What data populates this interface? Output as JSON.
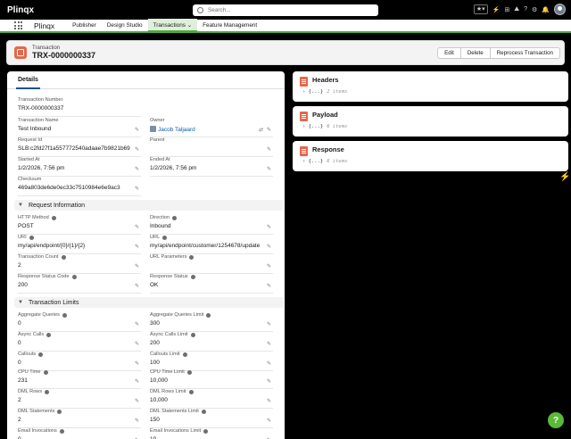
{
  "app": {
    "brand": "Plinqx",
    "search_placeholder": "Search...",
    "app_name": "Plinqx",
    "nav": [
      "Publisher",
      "Design Studio",
      "Transactions",
      "Feature Management"
    ]
  },
  "record": {
    "type": "Transaction",
    "name": "TRX-0000000337",
    "actions": [
      "Edit",
      "Delete",
      "Reprocess Transaction"
    ]
  },
  "details": {
    "tab": "Details",
    "fields": {
      "transaction_number": {
        "label": "Transaction Number",
        "value": "TRX-0000000337"
      },
      "transaction_name": {
        "label": "Transaction Name",
        "value": "Test Inbound"
      },
      "owner": {
        "label": "Owner",
        "value": "Jacob Taljaard"
      },
      "request_id": {
        "label": "Request Id",
        "value": "SLB:c2fd27f1a557772540adaae7b9821b69"
      },
      "parent": {
        "label": "Parent",
        "value": ""
      },
      "started_at": {
        "label": "Started At",
        "value": "1/2/2026, 7:56 pm"
      },
      "ended_at": {
        "label": "Ended At",
        "value": "1/2/2026, 7:56 pm"
      },
      "checksum": {
        "label": "Checksum",
        "value": "469a803de6de0ec33c7510984e6e9ac3"
      }
    }
  },
  "request_information": {
    "title": "Request Information",
    "fields": {
      "http_method": {
        "label": "HTTP Method",
        "value": "POST"
      },
      "direction": {
        "label": "Direction",
        "value": "Inbound"
      },
      "uri": {
        "label": "URI",
        "value": "my/api/endpoint/{0}/{1}/{2}"
      },
      "url": {
        "label": "URL",
        "value": "my/api/endpoint/customer/1254678/update"
      },
      "transaction_count": {
        "label": "Transaction Count",
        "value": "2"
      },
      "url_parameters": {
        "label": "URL Parameters",
        "value": ""
      },
      "response_status_code": {
        "label": "Response Status Code",
        "value": "200"
      },
      "response_status": {
        "label": "Response Status",
        "value": "OK"
      }
    }
  },
  "transaction_limits": {
    "title": "Transaction Limits",
    "fields": {
      "aggregate_queries": {
        "label": "Aggregate Queries",
        "value": "0"
      },
      "aggregate_queries_limit": {
        "label": "Aggregate Queries Limit",
        "value": "300"
      },
      "async_calls": {
        "label": "Async Calls",
        "value": "0"
      },
      "async_calls_limit": {
        "label": "Async Calls Limit",
        "value": "200"
      },
      "callouts": {
        "label": "Callouts",
        "value": "0"
      },
      "callouts_limit": {
        "label": "Callouts Limit",
        "value": "100"
      },
      "cpu_time": {
        "label": "CPU Time",
        "value": "231"
      },
      "cpu_time_limit": {
        "label": "CPU Time Limit",
        "value": "10,000"
      },
      "dml_rows": {
        "label": "DML Rows",
        "value": "2"
      },
      "dml_rows_limit": {
        "label": "DML Rows Limit",
        "value": "10,000"
      },
      "dml_statements": {
        "label": "DML Statements",
        "value": "2"
      },
      "dml_statements_limit": {
        "label": "DML Statements Limit",
        "value": "150"
      },
      "email_invocations": {
        "label": "Email Invocations",
        "value": "0"
      },
      "email_invocations_limit": {
        "label": "Email Invocations Limit",
        "value": "10"
      }
    }
  },
  "cards": [
    {
      "title": "Headers",
      "json": "{...}",
      "count": "2 items"
    },
    {
      "title": "Payload",
      "json": "{...}",
      "count": "6 items"
    },
    {
      "title": "Response",
      "json": "{...}",
      "count": "6 items"
    }
  ],
  "help_label": "?"
}
